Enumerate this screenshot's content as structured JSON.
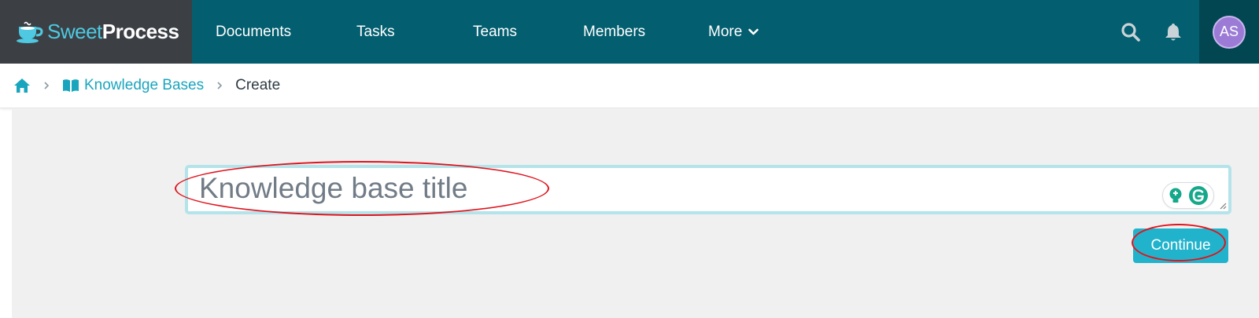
{
  "brand": {
    "name_light": "Sweet",
    "name_bold": "Process",
    "logo_icon": "teacup-icon"
  },
  "nav": {
    "documents": "Documents",
    "tasks": "Tasks",
    "teams": "Teams",
    "members": "Members",
    "more": "More"
  },
  "header_icons": {
    "search": "search-icon",
    "notifications": "bell-icon"
  },
  "user": {
    "initials": "AS"
  },
  "breadcrumb": {
    "home_icon": "home-icon",
    "kb_icon": "open-book-icon",
    "kb_label": "Knowledge Bases",
    "current": "Create"
  },
  "form": {
    "title_placeholder": "Knowledge base title",
    "title_value": "",
    "continue_label": "Continue"
  },
  "colors": {
    "topbar": "#035e6f",
    "brand_bg": "#3c4045",
    "accent": "#22b3cc",
    "link": "#1aa5be",
    "annotation": "#e0141e",
    "main_bg": "#f0f0f0"
  }
}
